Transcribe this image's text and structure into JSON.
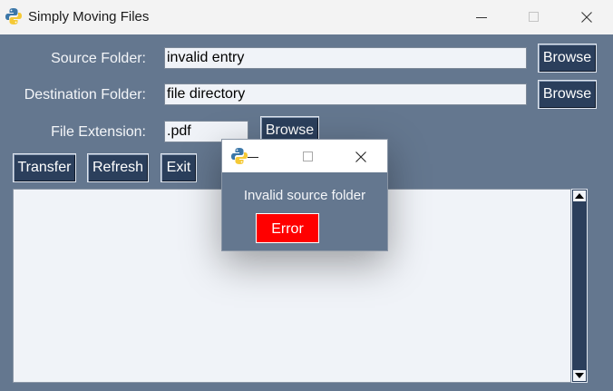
{
  "window": {
    "title": "Simply Moving Files",
    "icon": "python-icon"
  },
  "form": {
    "source_label": "Source Folder:",
    "source_value": "invalid entry",
    "destination_label": "Destination Folder:",
    "destination_value": "file directory",
    "extension_label": "File Extension:",
    "extension_value": ".pdf",
    "browse_label": "Browse"
  },
  "actions": {
    "transfer_label": "Transfer",
    "refresh_label": "Refresh",
    "exit_label": "Exit"
  },
  "popup": {
    "message": "Invalid source folder",
    "button_label": "Error"
  },
  "colors": {
    "background": "#64778f",
    "button": "#2b3f5c",
    "error": "#ff0000"
  }
}
